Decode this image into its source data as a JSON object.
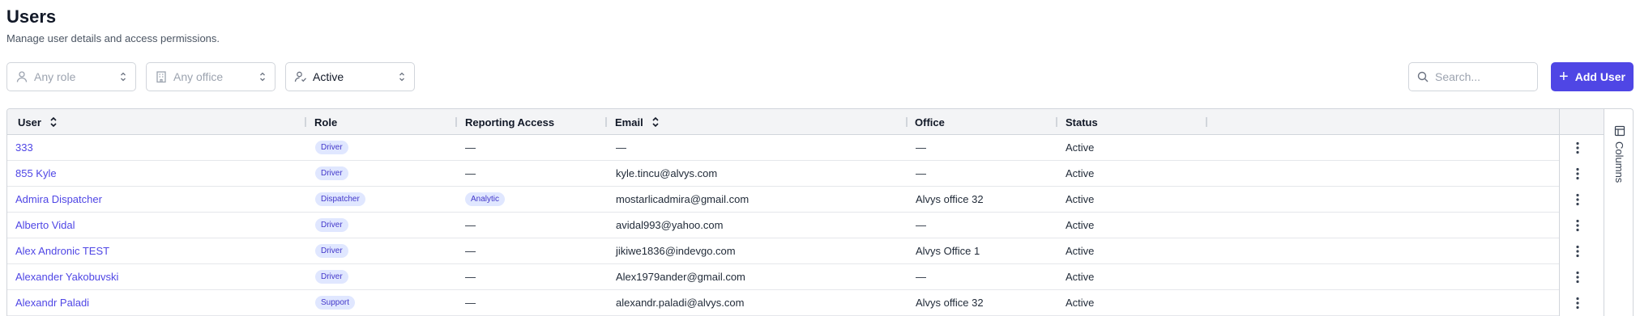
{
  "page": {
    "title": "Users",
    "subtitle": "Manage user details and access permissions."
  },
  "filters": {
    "role": {
      "label": "Any role",
      "icon": "user-icon"
    },
    "office": {
      "label": "Any office",
      "icon": "building-icon"
    },
    "status": {
      "label": "Active",
      "icon": "user-status-icon"
    }
  },
  "search": {
    "placeholder": "Search...",
    "value": ""
  },
  "add_button": {
    "label": "Add User"
  },
  "table": {
    "columns": {
      "user": "User",
      "role": "Role",
      "reporting": "Reporting Access",
      "email": "Email",
      "office": "Office",
      "status": "Status"
    },
    "rows": [
      {
        "user": "333",
        "role": "Driver",
        "reporting": "—",
        "email": "—",
        "office": "—",
        "status": "Active"
      },
      {
        "user": "855 Kyle",
        "role": "Driver",
        "reporting": "—",
        "email": "kyle.tincu@alvys.com",
        "office": "—",
        "status": "Active"
      },
      {
        "user": "Admira Dispatcher",
        "role": "Dispatcher",
        "reporting": "Analytic",
        "email": "mostarlicadmira@gmail.com",
        "office": "Alvys office 32",
        "status": "Active"
      },
      {
        "user": "Alberto Vidal",
        "role": "Driver",
        "reporting": "—",
        "email": "avidal993@yahoo.com",
        "office": "—",
        "status": "Active"
      },
      {
        "user": "Alex Andronic TEST",
        "role": "Driver",
        "reporting": "—",
        "email": "jikiwe1836@indevgo.com",
        "office": "Alvys Office 1",
        "status": "Active"
      },
      {
        "user": "Alexander Yakobuvski",
        "role": "Driver",
        "reporting": "—",
        "email": "Alex1979ander@gmail.com",
        "office": "—",
        "status": "Active"
      },
      {
        "user": "Alexandr Paladi",
        "role": "Support",
        "reporting": "—",
        "email": "alexandr.paladi@alvys.com",
        "office": "Alvys office 32",
        "status": "Active"
      }
    ]
  },
  "side_panel": {
    "columns_label": "Columns"
  },
  "colors": {
    "accent": "#4f46e5",
    "chip_bg": "#e0e7ff",
    "chip_text": "#4338ca"
  }
}
